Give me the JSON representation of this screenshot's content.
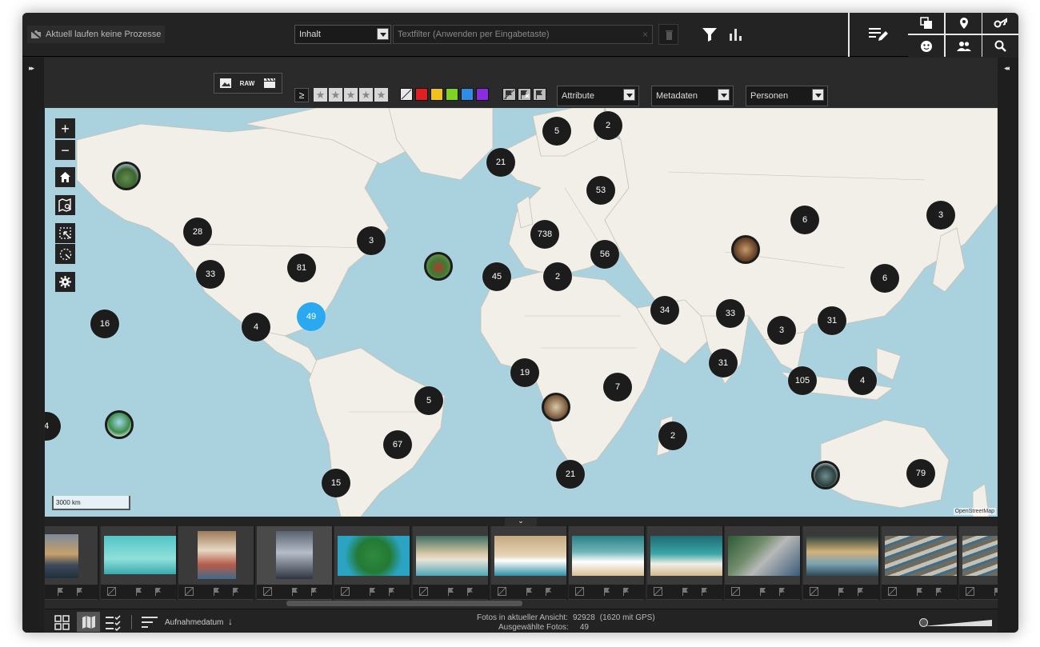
{
  "topbar": {
    "process_status": "Aktuell laufen keine Prozesse",
    "content_select": "Inhalt",
    "textfilter_placeholder": "Textfilter (Anwenden per Eingabetaste)",
    "clear_symbol": "×"
  },
  "toolbar": {
    "raw_label": "RAW",
    "rating_op": "≥",
    "stars": [
      "★",
      "★",
      "★",
      "★",
      "★"
    ],
    "color_labels": [
      "#e02020",
      "#f2c21b",
      "#7ed321",
      "#2e8de6",
      "#8b2be2"
    ],
    "attributes_select": "Attribute",
    "metadata_select": "Metadaten",
    "persons_select": "Personen"
  },
  "map": {
    "clusters": [
      {
        "label": "5"
      },
      {
        "label": "2"
      },
      {
        "label": "21"
      },
      {
        "label": "53"
      },
      {
        "label": "28"
      },
      {
        "label": "3"
      },
      {
        "label": "738"
      },
      {
        "label": "6"
      },
      {
        "label": "3"
      },
      {
        "label": "56"
      },
      {
        "label": "33"
      },
      {
        "label": "81"
      },
      {
        "label": "45"
      },
      {
        "label": "2"
      },
      {
        "label": "6"
      },
      {
        "label": "49"
      },
      {
        "label": "16"
      },
      {
        "label": "4"
      },
      {
        "label": "34"
      },
      {
        "label": "33"
      },
      {
        "label": "3"
      },
      {
        "label": "31"
      },
      {
        "label": "31"
      },
      {
        "label": "19"
      },
      {
        "label": "7"
      },
      {
        "label": "105"
      },
      {
        "label": "4"
      },
      {
        "label": "5"
      },
      {
        "label": "2"
      },
      {
        "label": "67"
      },
      {
        "label": "21"
      },
      {
        "label": "79"
      },
      {
        "label": "15"
      },
      {
        "label": "4"
      }
    ],
    "selected_cluster": "49",
    "scale_label": "3000 km",
    "attribution": "OpenStreetMap"
  },
  "filmstrip": {
    "collapse_symbol": "⌄"
  },
  "statusbar": {
    "sort_label": "Aufnahmedatum",
    "sort_arrow": "↓",
    "photos_in_view_label": "Fotos in aktueller Ansicht:",
    "photos_in_view_value": "92928",
    "photos_gps": "(1620 mit GPS)",
    "selected_label": "Ausgewählte Fotos:",
    "selected_value": "49"
  },
  "side": {
    "expand_left": "▸▸",
    "collapse_right": "◂◂"
  }
}
